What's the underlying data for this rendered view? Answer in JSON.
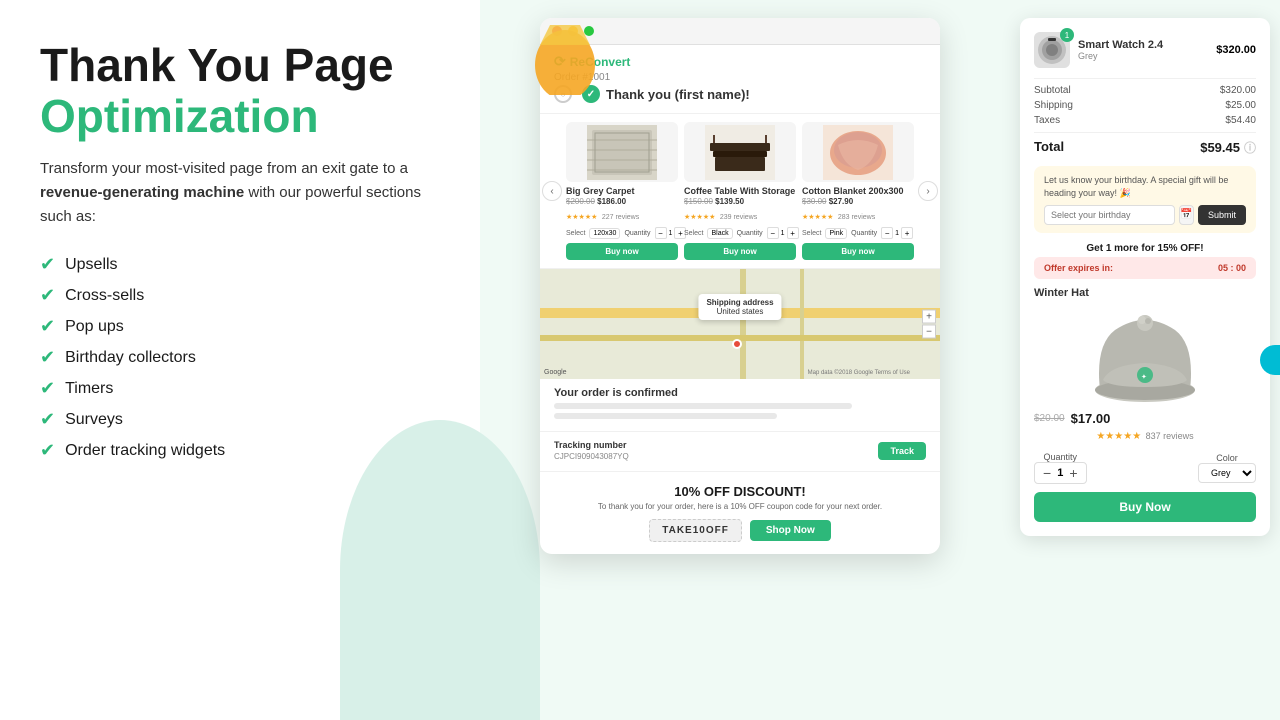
{
  "left": {
    "heading_line1": "Thank You Page",
    "heading_line2": "Optimization",
    "subtext_part1": "Transform your most-visited page from an exit gate to a",
    "subtext_bold": "revenue-generating machine",
    "subtext_part2": "with our powerful sections such as:",
    "features": [
      "Upsells",
      "Cross-sells",
      "Pop ups",
      "Birthday collectors",
      "Timers",
      "Surveys",
      "Order tracking widgets"
    ]
  },
  "browser": {
    "logo": "ReConvert",
    "order_number": "Order #1001",
    "thank_you": "Thank you (first name)!",
    "products": [
      {
        "name": "Big Grey Carpet",
        "old_price": "$200.00",
        "new_price": "$186.00",
        "stars": "★★★★★",
        "reviews": "227 reviews",
        "select_label": "Select",
        "select_value": "120x30",
        "qty": "1",
        "buy_label": "Buy now",
        "color": "#d8d5c8"
      },
      {
        "name": "Coffee Table With Storage",
        "old_price": "$150.00",
        "new_price": "$139.50",
        "stars": "★★★★★",
        "reviews": "239 reviews",
        "select_label": "Select",
        "select_value": "Black",
        "qty": "1",
        "buy_label": "Buy now",
        "color": "#5a4a3a"
      },
      {
        "name": "Cotton Blanket 200x300",
        "old_price": "$30.00",
        "new_price": "$27.90",
        "stars": "★★★★★",
        "reviews": "283 reviews",
        "select_label": "Select",
        "select_value": "Pink",
        "qty": "1",
        "buy_label": "Buy now",
        "color": "#e8b4a0"
      }
    ],
    "map_tooltip_line1": "Shipping address",
    "map_tooltip_line2": "United states",
    "order_confirmed": "Your order is confirmed",
    "tracking_label": "Tracking number",
    "tracking_number": "CJPCI909043087YQ",
    "track_btn": "Track",
    "discount_title": "10% OFF DISCOUNT!",
    "discount_sub": "To thank you for your order, here is a 10% OFF coupon code for your next order.",
    "coupon_code": "TAKE10OFF",
    "shop_now": "Shop Now"
  },
  "order_summary": {
    "item_name": "Smart Watch 2.4",
    "item_variant": "Grey",
    "item_price": "$320.00",
    "badge": "1",
    "subtotal_label": "Subtotal",
    "subtotal_value": "$320.00",
    "shipping_label": "Shipping",
    "shipping_value": "$25.00",
    "taxes_label": "Taxes",
    "taxes_value": "$54.40",
    "total_label": "Total",
    "total_value": "$59.45",
    "birthday_text": "Let us know your birthday. A special gift will be heading your way! 🎉",
    "birthday_placeholder": "Select your birthday",
    "birthday_submit": "Submit",
    "upsell_text": "Get 1 more for 15% OFF!",
    "offer_label": "Offer expires in:",
    "offer_timer": "05 : 00",
    "winter_hat_title": "Winter Hat",
    "hat_old_price": "$20.00",
    "hat_new_price": "$17.00",
    "hat_stars": "★★★★★",
    "hat_reviews": "837 reviews",
    "qty_label": "Quantity",
    "qty_value": "1",
    "color_label": "Color",
    "color_value": "Grey",
    "buy_now_label": "Buy Now"
  }
}
